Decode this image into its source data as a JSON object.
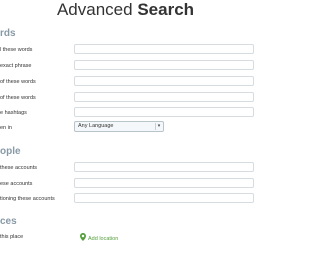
{
  "page": {
    "title_prefix": "Advanced",
    "title_bold": "Search"
  },
  "words": {
    "heading": "rds",
    "rows": [
      {
        "label": "l these words"
      },
      {
        "label": "exact phrase"
      },
      {
        "label": "of these words"
      },
      {
        "label": "of these words"
      },
      {
        "label": "e hashtags"
      },
      {
        "label": "en in"
      }
    ],
    "language_select": {
      "value": "Any Language"
    }
  },
  "people": {
    "heading": "ople",
    "rows": [
      {
        "label": "these accounts"
      },
      {
        "label": "ese accounts"
      },
      {
        "label": "tioning these accounts"
      }
    ]
  },
  "places": {
    "heading": "ces",
    "rows": [
      {
        "label": "this place"
      }
    ],
    "add_location": "Add location"
  },
  "colors": {
    "section_heading": "#8899a6",
    "link_green": "#55a03d",
    "field_border": "#d6dce0"
  }
}
